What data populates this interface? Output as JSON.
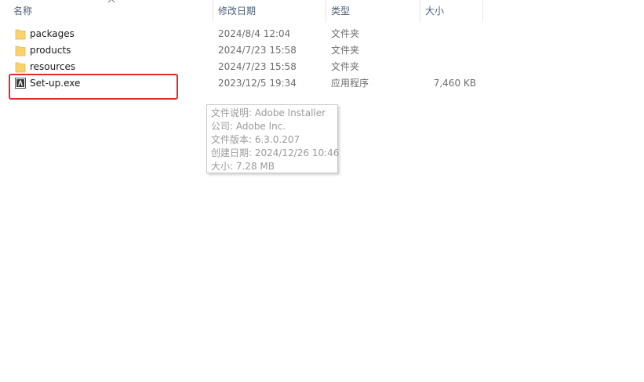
{
  "columns": {
    "name": "名称",
    "date": "修改日期",
    "type": "类型",
    "size": "大小"
  },
  "files": [
    {
      "name": "packages",
      "date": "2024/8/4 12:04",
      "type": "文件夹",
      "size": "",
      "icon": "folder-icon"
    },
    {
      "name": "products",
      "date": "2024/7/23 15:58",
      "type": "文件夹",
      "size": "",
      "icon": "folder-icon"
    },
    {
      "name": "resources",
      "date": "2024/7/23 15:58",
      "type": "文件夹",
      "size": "",
      "icon": "folder-icon"
    },
    {
      "name": "Set-up.exe",
      "date": "2023/12/5 19:34",
      "type": "应用程序",
      "size": "7,460 KB",
      "icon": "adobe-installer-icon"
    }
  ],
  "tooltip": {
    "description": "文件说明: Adobe Installer",
    "company": "公司: Adobe Inc.",
    "version": "文件版本: 6.3.0.207",
    "created": "创建日期: 2024/12/26 10:46",
    "size": "大小: 7.28 MB"
  },
  "colors": {
    "highlight": "#e42a2a",
    "folder": "#f8d26a",
    "header_text": "#4c607a"
  }
}
